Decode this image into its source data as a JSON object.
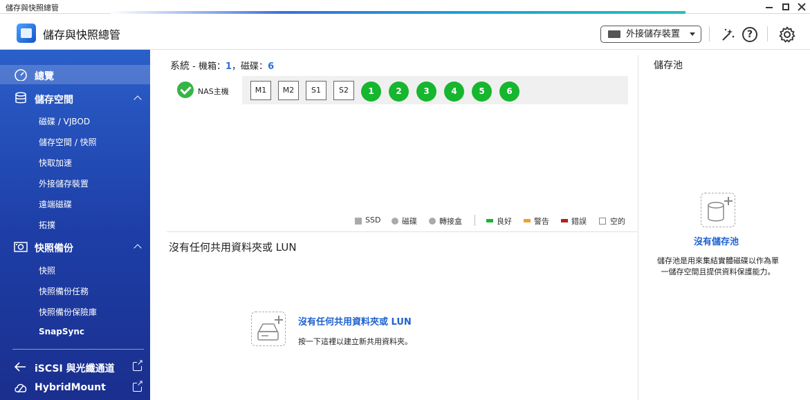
{
  "window": {
    "title": "儲存與快照總管"
  },
  "header": {
    "app_title": "儲存與快照總管",
    "external_device_label": "外接儲存裝置"
  },
  "sidebar": {
    "overview": "總覽",
    "storage": "儲存空間",
    "storage_items": [
      "磁碟 / VJBOD",
      "儲存空間 / 快照",
      "快取加速",
      "外接儲存裝置",
      "遠端磁碟",
      "拓撲"
    ],
    "snapshot_backup": "快照備份",
    "snapshot_items": [
      "快照",
      "快照備份任務",
      "快照備份保險庫",
      "SnapSync"
    ],
    "iscsi": "iSCSI 與光纖通道",
    "hybridmount": "HybridMount"
  },
  "system": {
    "label": "系統",
    "enclosure_label": "機箱：",
    "enclosure_count": "1",
    "disk_label": "磁碟：",
    "disk_count": "6",
    "nas_label": "NAS主機",
    "slots": [
      "M1",
      "M2",
      "S1",
      "S2"
    ],
    "disks": [
      "1",
      "2",
      "3",
      "4",
      "5",
      "6"
    ]
  },
  "legend": {
    "ssd": "SSD",
    "disk": "磁碟",
    "adapter": "轉接盒",
    "good": "良好",
    "warning": "警告",
    "error": "錯誤",
    "empty": "空的",
    "colors": {
      "good": "#16b62e",
      "warning": "#f0a030",
      "error": "#b32020"
    }
  },
  "shares": {
    "title": "沒有任何共用資料夾或 LUN",
    "empty_link": "沒有任何共用資料夾或 LUN",
    "empty_desc": "按一下這裡以建立新共用資料夾。"
  },
  "pool": {
    "title": "儲存池",
    "empty_link": "沒有儲存池",
    "empty_desc": "儲存池是用來集結實體磁碟以作為單一儲存空間且提供資料保護能力。"
  }
}
